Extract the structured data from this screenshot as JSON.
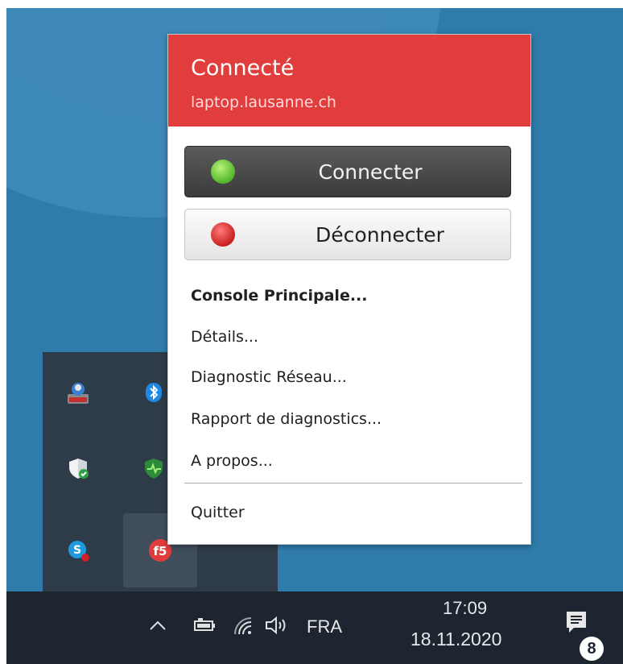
{
  "popup": {
    "status_title": "Connecté",
    "status_host": "laptop.lausanne.ch",
    "header_color": "#e23d3d",
    "connect_button": {
      "label": "Connecter",
      "icon": "power-icon-green"
    },
    "disconnect_button": {
      "label": "Déconnecter",
      "icon": "power-icon-red"
    },
    "menu": [
      {
        "label": "Console Principale...",
        "bold": true
      },
      {
        "label": "Détails..."
      },
      {
        "label": "Diagnostic Réseau..."
      },
      {
        "label": "Rapport de diagnostics..."
      },
      {
        "label": "A propos..."
      },
      {
        "label": "Quitter"
      }
    ]
  },
  "tray_overflow": {
    "icons": [
      "network-admin-icon",
      "bluetooth-icon",
      "windows-security-icon",
      "health-monitor-icon",
      "skype-icon",
      "f5-vpn-icon"
    ]
  },
  "taskbar": {
    "language": "FRA",
    "time": "17:09",
    "date": "18.11.2020",
    "notifications_count": "8"
  }
}
